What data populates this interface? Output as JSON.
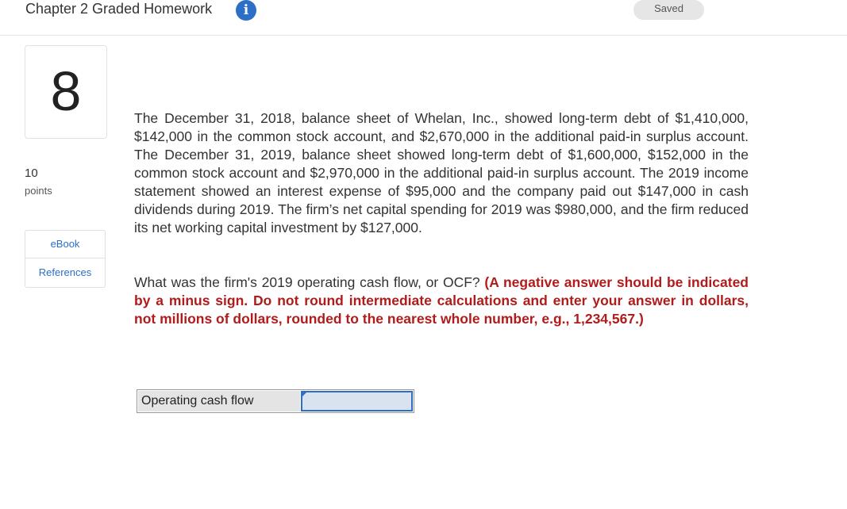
{
  "header": {
    "title": "Chapter 2 Graded Homework",
    "info_glyph": "i",
    "saved_label": "Saved"
  },
  "sidebar": {
    "question_number": "8",
    "points_value": "10",
    "points_label": "points",
    "ebook_label": "eBook",
    "references_label": "References"
  },
  "question": {
    "body": "The December 31, 2018, balance sheet of Whelan, Inc., showed long-term debt of $1,410,000, $142,000 in the common stock account, and $2,670,000 in the additional paid-in surplus account. The December 31, 2019, balance sheet showed long-term debt of $1,600,000, $152,000 in the common stock account and $2,970,000 in the additional paid-in surplus account. The 2019 income statement showed an interest expense of $95,000 and the company paid out $147,000 in cash dividends during 2019. The firm’s net capital spending for 2019 was $980,000, and the firm reduced its net working capital investment by $127,000.",
    "prompt": "What was the firm's 2019 operating cash flow, or OCF? ",
    "instructions": "(A negative answer should be indicated by a minus sign. Do not round intermediate calculations and enter your answer in dollars, not millions of dollars, rounded to the nearest whole number, e.g., 1,234,567.)"
  },
  "answer": {
    "label": "Operating cash flow",
    "value": ""
  },
  "colors": {
    "accent": "#2d6ec7",
    "instruction_red": "#b01c1c"
  },
  "icons": {
    "info": "info-icon",
    "input_flag": "flag-icon"
  }
}
